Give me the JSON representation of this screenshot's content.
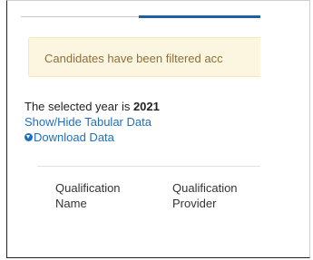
{
  "alert": {
    "text": "Candidates have been filtered acc"
  },
  "selection": {
    "prefix": "The selected year is ",
    "year": "2021"
  },
  "links": {
    "toggle_table": "Show/Hide Tabular Data",
    "download": "Download Data"
  },
  "table": {
    "headers": [
      {
        "line1": "Qualification",
        "line2": "Name"
      },
      {
        "line1": "Qualification",
        "line2": "Provider"
      }
    ]
  },
  "colors": {
    "link": "#1f6fbf",
    "active_tab": "#1f5fa8",
    "alert_bg": "#fcf6e1",
    "alert_text": "#8b6f3a"
  },
  "icons": {
    "download": "download-circle-icon"
  }
}
